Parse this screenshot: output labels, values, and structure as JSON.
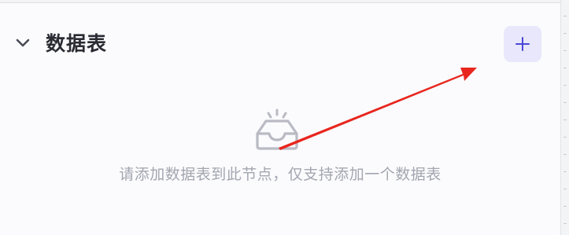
{
  "section": {
    "title": "数据表",
    "add_button_label": "+",
    "collapse_icon": "chevron-down-icon"
  },
  "empty_state": {
    "icon": "empty-inbox-icon",
    "message": "请添加数据表到此节点，仅支持添加一个数据表"
  },
  "colors": {
    "accent": "#4b48d6",
    "add_button_bg": "#e8e7fb",
    "annotation_arrow": "#e8261e",
    "empty_text": "#a3a6b0",
    "title_text": "#2a2b33"
  }
}
